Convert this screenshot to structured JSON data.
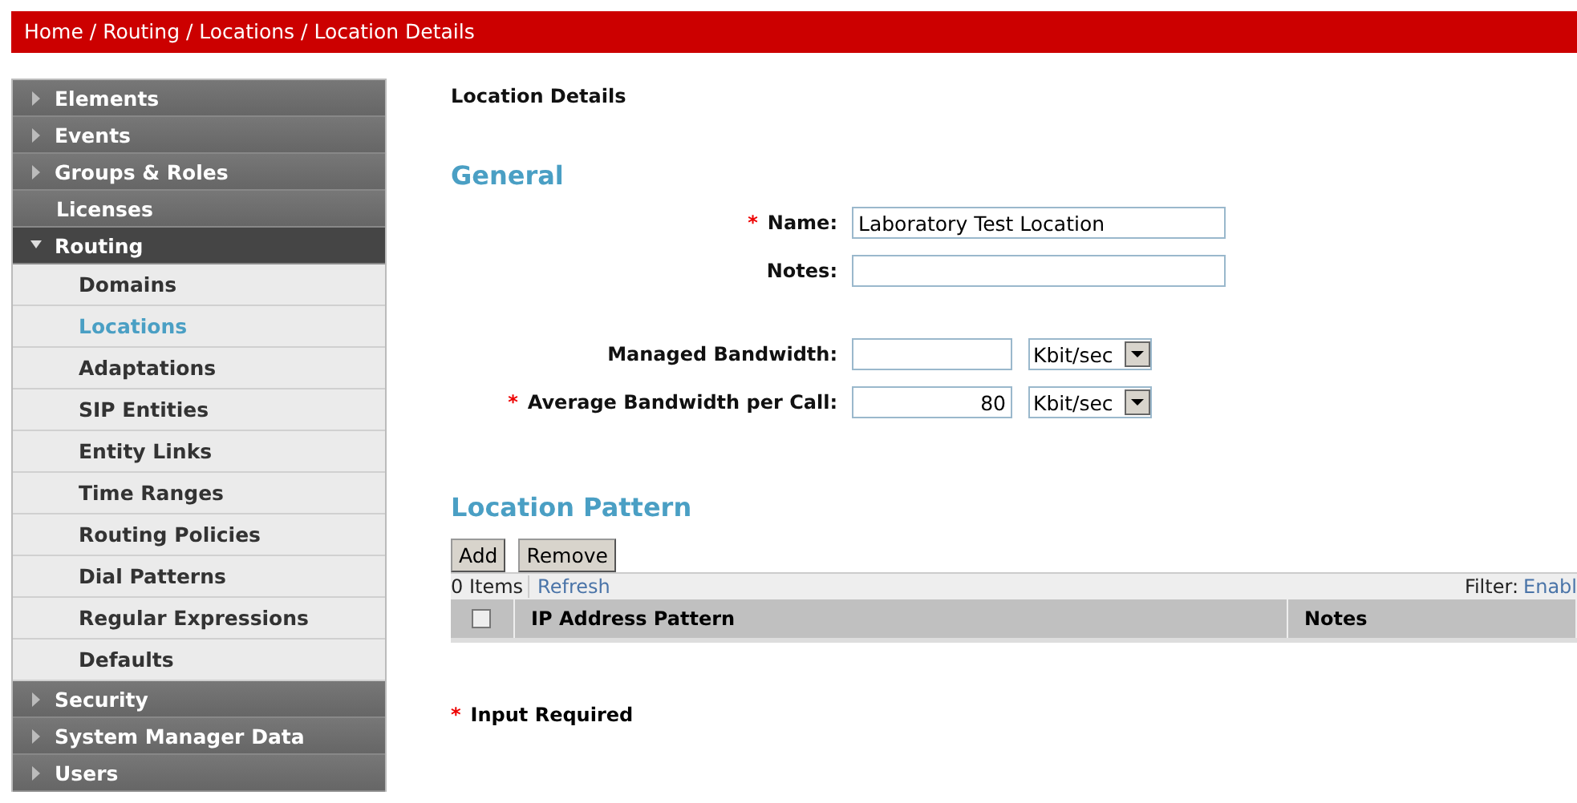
{
  "breadcrumb": "Home / Routing / Locations / Location Details",
  "sidebar": {
    "items": [
      {
        "label": "Elements",
        "kind": "group",
        "expanded": false
      },
      {
        "label": "Events",
        "kind": "group",
        "expanded": false
      },
      {
        "label": "Groups & Roles",
        "kind": "group",
        "expanded": false
      },
      {
        "label": "Licenses",
        "kind": "link"
      },
      {
        "label": "Routing",
        "kind": "group",
        "expanded": true,
        "children": [
          {
            "label": "Domains",
            "selected": false
          },
          {
            "label": "Locations",
            "selected": true
          },
          {
            "label": "Adaptations",
            "selected": false
          },
          {
            "label": "SIP Entities",
            "selected": false
          },
          {
            "label": "Entity Links",
            "selected": false
          },
          {
            "label": "Time Ranges",
            "selected": false
          },
          {
            "label": "Routing Policies",
            "selected": false
          },
          {
            "label": "Dial Patterns",
            "selected": false
          },
          {
            "label": "Regular Expressions",
            "selected": false
          },
          {
            "label": "Defaults",
            "selected": false
          }
        ]
      },
      {
        "label": "Security",
        "kind": "group",
        "expanded": false
      },
      {
        "label": "System Manager Data",
        "kind": "group",
        "expanded": false
      },
      {
        "label": "Users",
        "kind": "group",
        "expanded": false
      }
    ]
  },
  "page_title": "Location Details",
  "required_mark": "*",
  "general": {
    "title": "General",
    "fields": [
      {
        "kind": "text",
        "label": "Name:",
        "required": true,
        "value": "Laboratory Test Location"
      },
      {
        "kind": "text",
        "label": "Notes:",
        "required": false
      },
      {
        "kind": "spacer"
      },
      {
        "kind": "bandwidth",
        "label": "Managed Bandwidth:",
        "required": false,
        "unit": "Kbit/sec"
      },
      {
        "kind": "bandwidth",
        "label": "Average Bandwidth per Call:",
        "required": true,
        "value": "80",
        "unit": "Kbit/sec"
      }
    ]
  },
  "location_pattern": {
    "title": "Location Pattern",
    "buttons": [
      "Add",
      "Remove"
    ],
    "count": "0 Items",
    "refresh": "Refresh",
    "filter_label": "Filter:",
    "filter_link": "Enabl",
    "select_all_checked": false,
    "columns": [
      "IP Address Pattern",
      "Notes"
    ]
  },
  "footer": "Input Required"
}
